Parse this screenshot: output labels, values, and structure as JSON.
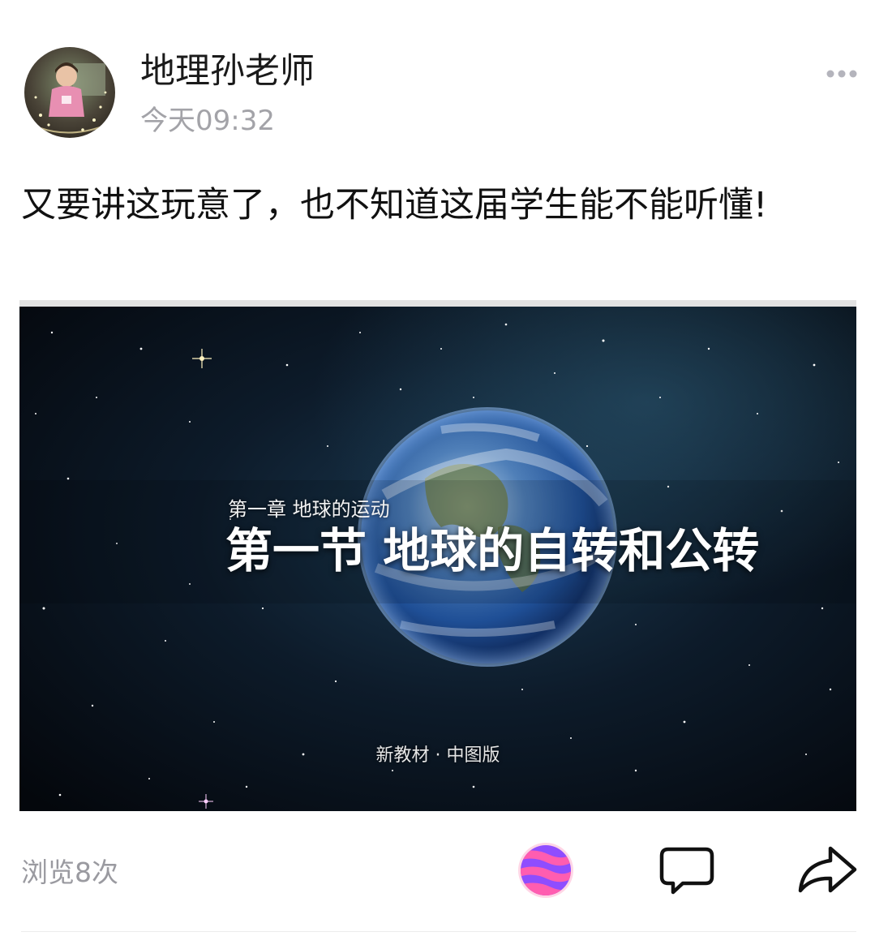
{
  "post": {
    "author": "地理孙老师",
    "time": "今天09:32",
    "text": "又要讲这玩意了，也不知道这届学生能不能听懂!",
    "image": {
      "chapter": "第一章  地球的运动",
      "title": "第一节 地球的自转和公转",
      "edition": "新教材 · 中图版"
    }
  },
  "footer": {
    "views": "浏览8次"
  },
  "icons": {
    "more": "more-dots-icon",
    "reaction": "planet-reaction-icon",
    "comment": "comment-icon",
    "share": "share-arrow-icon"
  },
  "colors": {
    "name": "#1a1a1a",
    "meta": "#a3a3a8",
    "reaction_gradient": [
      "#ff6fb4",
      "#7b3cff"
    ]
  }
}
